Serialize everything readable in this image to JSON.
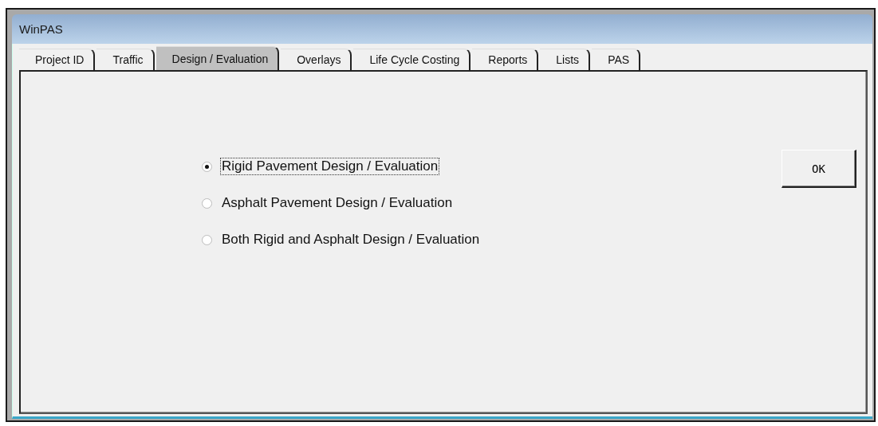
{
  "window": {
    "title": "WinPAS"
  },
  "tabs": [
    {
      "label": "Project ID",
      "selected": false
    },
    {
      "label": "Traffic",
      "selected": false
    },
    {
      "label": "Design / Evaluation",
      "selected": true
    },
    {
      "label": "Overlays",
      "selected": false
    },
    {
      "label": "Life Cycle Costing",
      "selected": false
    },
    {
      "label": "Reports",
      "selected": false
    },
    {
      "label": "Lists",
      "selected": false
    },
    {
      "label": "PAS",
      "selected": false
    }
  ],
  "options": [
    {
      "label": "Rigid Pavement Design / Evaluation",
      "selected": true,
      "focused": true
    },
    {
      "label": "Asphalt Pavement Design / Evaluation",
      "selected": false,
      "focused": false
    },
    {
      "label": "Both Rigid and Asphalt Design / Evaluation",
      "selected": false,
      "focused": false
    }
  ],
  "buttons": [
    "OK"
  ]
}
